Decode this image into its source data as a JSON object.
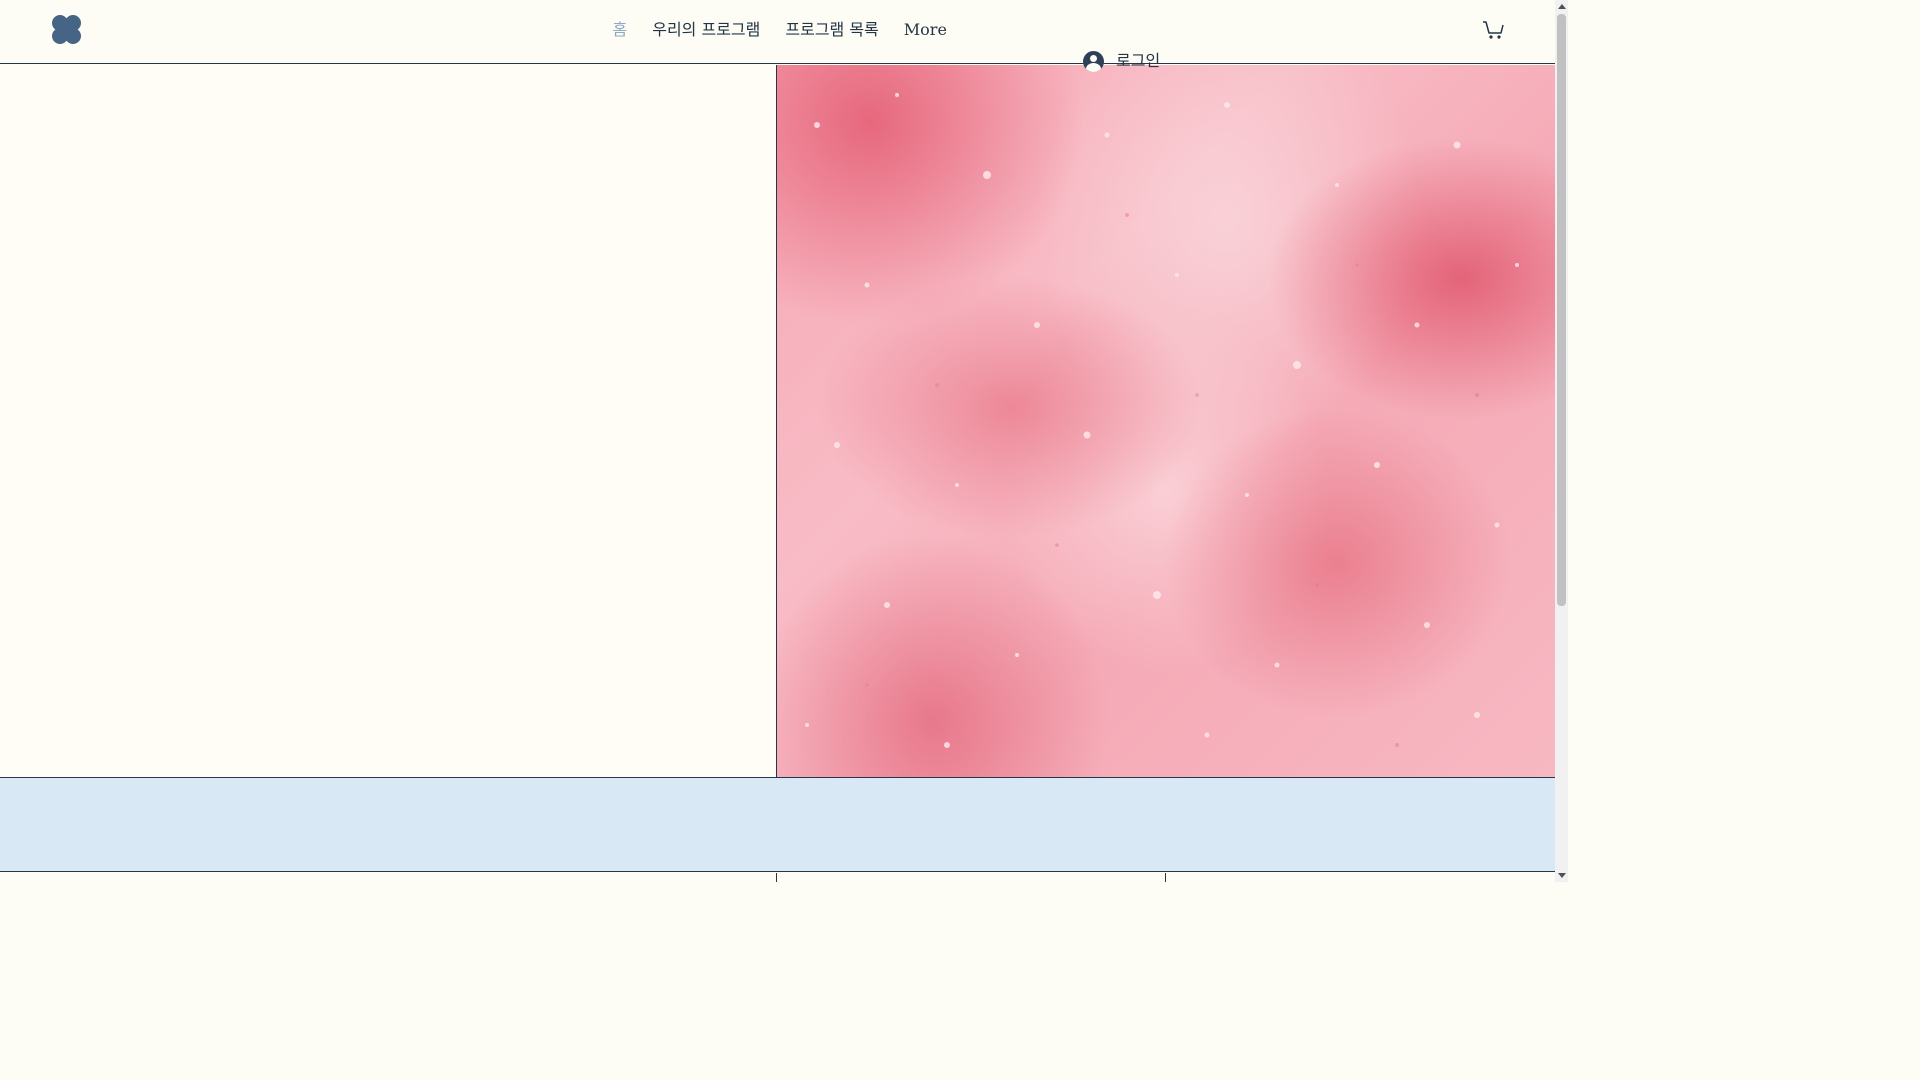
{
  "header": {
    "logo_icon": "clover-logo-icon",
    "nav": [
      {
        "label": "홈",
        "active": true
      },
      {
        "label": "우리의 프로그램",
        "active": false
      },
      {
        "label": "프로그램 목록",
        "active": false
      },
      {
        "label": "More",
        "active": false
      }
    ],
    "login_label": "로그인",
    "login_icon": "user-avatar-icon",
    "cart_icon": "cart-icon"
  },
  "hero": {
    "image": "pink-salt-texture-image"
  },
  "colors": {
    "background": "#fefdf5",
    "nav_text": "#233545",
    "nav_active": "#8ea8c6",
    "logo": "#456486",
    "band": "#d8e8f5",
    "divider": "#26364a"
  }
}
